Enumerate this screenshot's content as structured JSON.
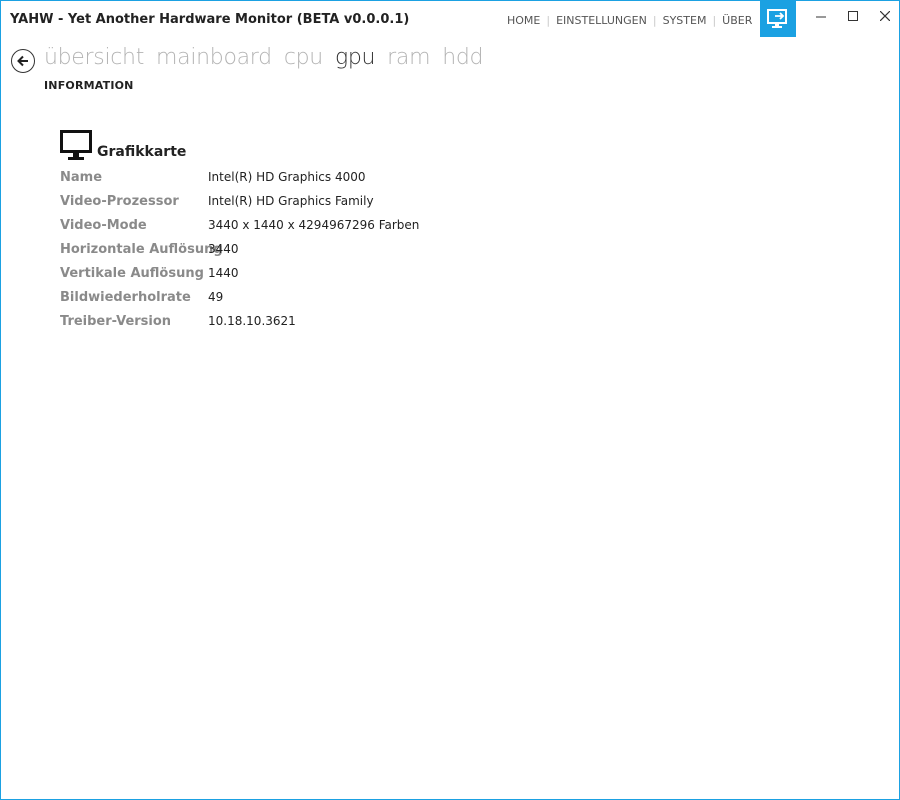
{
  "window": {
    "app_name": "YAHW",
    "title_rest": " - Yet Another Hardware Monitor (BETA v0.0.0.1)",
    "accent_color": "#1ba1e2"
  },
  "topnav": [
    {
      "label": "HOME"
    },
    {
      "label": "EINSTELLUNGEN"
    },
    {
      "label": "SYSTEM"
    },
    {
      "label": "ÜBER"
    }
  ],
  "icons": {
    "remote": "remote-desktop-icon",
    "back": "back-arrow-icon",
    "section": "monitor-icon"
  },
  "pagetabs": [
    {
      "label": "übersicht",
      "active": false
    },
    {
      "label": "mainboard",
      "active": false
    },
    {
      "label": "cpu",
      "active": false
    },
    {
      "label": "gpu",
      "active": true
    },
    {
      "label": "ram",
      "active": false
    },
    {
      "label": "hdd",
      "active": false
    }
  ],
  "subsection": "INFORMATION",
  "card": {
    "title": "Grafikkarte",
    "rows": [
      {
        "label": "Name",
        "value": "Intel(R) HD Graphics 4000"
      },
      {
        "label": "Video-Prozessor",
        "value": "Intel(R) HD Graphics Family"
      },
      {
        "label": "Video-Mode",
        "value": "3440 x 1440 x 4294967296 Farben"
      },
      {
        "label": "Horizontale Auflösung",
        "value": "3440"
      },
      {
        "label": "Vertikale Auflösung",
        "value": "1440"
      },
      {
        "label": "Bildwiederholrate",
        "value": "49"
      },
      {
        "label": "Treiber-Version",
        "value": "10.18.10.3621"
      }
    ]
  }
}
